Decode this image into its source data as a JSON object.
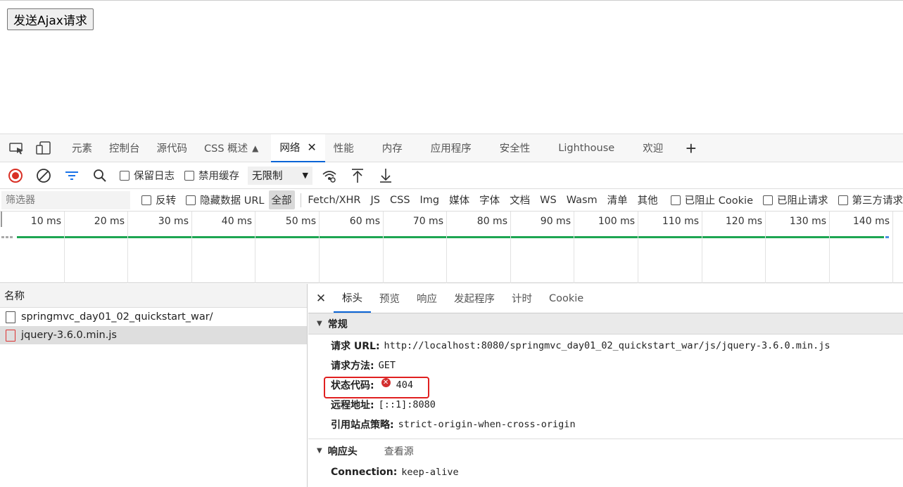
{
  "page": {
    "ajax_button": "发送Ajax请求"
  },
  "devtools": {
    "tabs": [
      "元素",
      "控制台",
      "源代码",
      "CSS 概述",
      "网络",
      "性能",
      "内存",
      "应用程序",
      "安全性",
      "Lighthouse",
      "欢迎"
    ],
    "active_tab": "网络",
    "toolbar": {
      "preserve_log": "保留日志",
      "disable_cache": "禁用缓存",
      "throttle": "无限制"
    },
    "filter": {
      "placeholder": "筛选器",
      "invert": "反转",
      "hide_data_urls": "隐藏数据 URL",
      "types": [
        "全部",
        "Fetch/XHR",
        "JS",
        "CSS",
        "Img",
        "媒体",
        "字体",
        "文档",
        "WS",
        "Wasm",
        "清单",
        "其他"
      ],
      "blocked_cookies": "已阻止 Cookie",
      "blocked_requests": "已阻止请求",
      "third_party": "第三方请求"
    },
    "timeline": {
      "ticks": [
        "10 ms",
        "20 ms",
        "30 ms",
        "40 ms",
        "50 ms",
        "60 ms",
        "70 ms",
        "80 ms",
        "90 ms",
        "100 ms",
        "110 ms",
        "120 ms",
        "130 ms",
        "140 ms"
      ]
    },
    "names": {
      "header": "名称",
      "rows": [
        {
          "name": "springmvc_day01_02_quickstart_war/",
          "error": false
        },
        {
          "name": "jquery-3.6.0.min.js",
          "error": true
        }
      ]
    },
    "details": {
      "tabs": [
        "标头",
        "预览",
        "响应",
        "发起程序",
        "计时",
        "Cookie"
      ],
      "general": {
        "title": "常规",
        "request_url_k": "请求 URL:",
        "request_url_v": "http://localhost:8080/springmvc_day01_02_quickstart_war/js/jquery-3.6.0.min.js",
        "method_k": "请求方法:",
        "method_v": "GET",
        "status_k": "状态代码:",
        "status_v": "404",
        "remote_k": "远程地址:",
        "remote_v": "[::1]:8080",
        "referrer_k": "引用站点策略:",
        "referrer_v": "strict-origin-when-cross-origin"
      },
      "response_headers": {
        "title": "响应头",
        "view_source": "查看源",
        "connection_k": "Connection:",
        "connection_v": "keep-alive"
      }
    }
  }
}
